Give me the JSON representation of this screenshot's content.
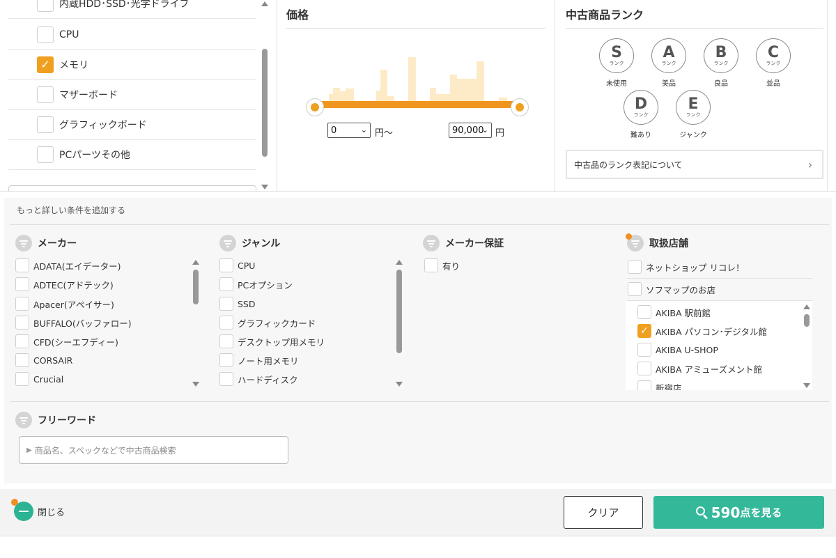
{
  "categories": [
    {
      "label": "内蔵HDD･SSD･光学ドライブ",
      "checked": false
    },
    {
      "label": "CPU",
      "checked": false
    },
    {
      "label": "メモリ",
      "checked": true
    },
    {
      "label": "マザーボード",
      "checked": false
    },
    {
      "label": "グラフィックボード",
      "checked": false
    },
    {
      "label": "PCパーツその他",
      "checked": false
    }
  ],
  "price": {
    "title": "価格",
    "min_value": "0",
    "max_value": "90,000",
    "unit_from": "円～",
    "unit_to": "円"
  },
  "rank": {
    "title": "中古商品ランク",
    "sub_label": "ランク",
    "items": [
      {
        "letter": "S",
        "caption": "未使用"
      },
      {
        "letter": "A",
        "caption": "美品"
      },
      {
        "letter": "B",
        "caption": "良品"
      },
      {
        "letter": "C",
        "caption": "並品"
      },
      {
        "letter": "D",
        "caption": "難あり"
      },
      {
        "letter": "E",
        "caption": "ジャンク"
      }
    ],
    "link": "中古品のランク表記について"
  },
  "detail": {
    "heading": "もっと詳しい条件を追加する",
    "maker": {
      "title": "メーカー",
      "options": [
        "ADATA(エイデーター)",
        "ADTEC(アドテック)",
        "Apacer(アペイサー)",
        "BUFFALO(バッファロー)",
        "CFD(シーエフディー)",
        "CORSAIR",
        "Crucial"
      ]
    },
    "genre": {
      "title": "ジャンル",
      "options": [
        "CPU",
        "PCオプション",
        "SSD",
        "グラフィックカード",
        "デスクトップ用メモリ",
        "ノート用メモリ",
        "ハードディスク"
      ]
    },
    "warranty": {
      "title": "メーカー保証",
      "options": [
        "有り"
      ]
    },
    "stores": {
      "title": "取扱店舗",
      "options": [
        "ネットショップ リコレ！",
        "ソフマップのお店"
      ],
      "sub_options": [
        {
          "label": "AKIBA 駅前館",
          "checked": false
        },
        {
          "label": "AKIBA パソコン･デジタル館",
          "checked": true
        },
        {
          "label": "AKIBA U-SHOP",
          "checked": false
        },
        {
          "label": "AKIBA アミューズメント館",
          "checked": false
        },
        {
          "label": "新宿店",
          "checked": false
        }
      ]
    },
    "freeword": {
      "title": "フリーワード",
      "placeholder": "商品名、スペックなどで中古商品検索"
    }
  },
  "footer": {
    "close_label": "閉じる",
    "clear_label": "クリア",
    "count": "590",
    "see_suffix": "点を見る"
  },
  "colors": {
    "accent_orange": "#f0961e",
    "primary_green": "#34b89a",
    "histogram": "#fdebc8"
  }
}
